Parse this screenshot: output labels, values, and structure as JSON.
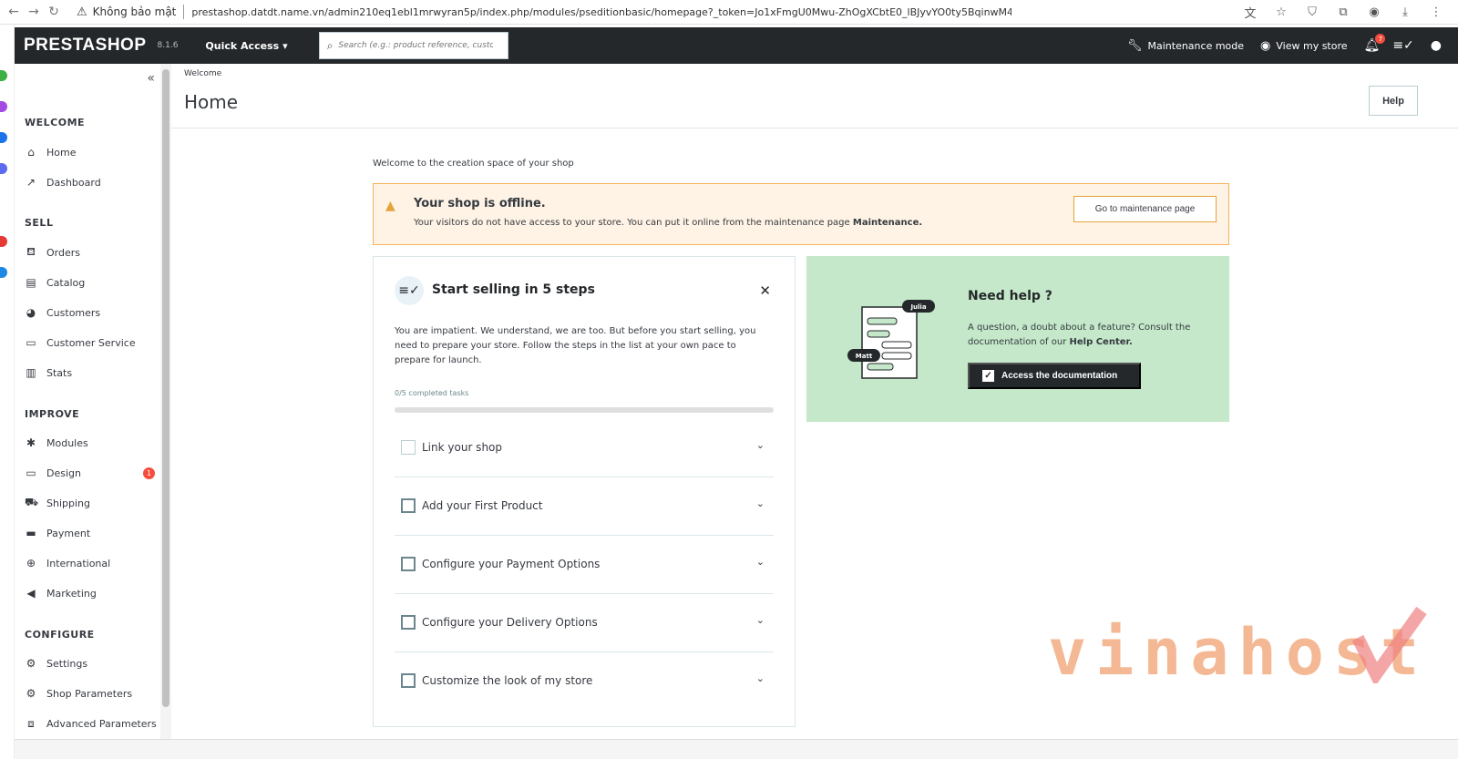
{
  "browser": {
    "security_label": "Không bảo mật",
    "url": "prestashop.datdt.name.vn/admin210eq1ebl1mrwyran5p/index.php/modules/pseditionbasic/homepage?_token=Jo1xFmgU0Mwu-ZhOgXCbtE0_lBJyvYO0ty5BqinwM48"
  },
  "header": {
    "logo": "PRESTASHOP",
    "version": "8.1.6",
    "quick_access": "Quick Access",
    "search_placeholder": "Search (e.g.: product reference, custom",
    "maintenance_mode": "Maintenance mode",
    "view_store": "View my store",
    "notification_count": "7"
  },
  "sidebar": {
    "sections": [
      {
        "title": "WELCOME",
        "items": [
          {
            "label": "Home",
            "icon": "home-icon"
          },
          {
            "label": "Dashboard",
            "icon": "trending-up-icon"
          }
        ]
      },
      {
        "title": "SELL",
        "items": [
          {
            "label": "Orders",
            "icon": "basket-icon"
          },
          {
            "label": "Catalog",
            "icon": "store-icon"
          },
          {
            "label": "Customers",
            "icon": "account-circle-icon"
          },
          {
            "label": "Customer Service",
            "icon": "chat-icon"
          },
          {
            "label": "Stats",
            "icon": "bar-chart-icon"
          }
        ]
      },
      {
        "title": "IMPROVE",
        "items": [
          {
            "label": "Modules",
            "icon": "puzzle-icon"
          },
          {
            "label": "Design",
            "icon": "desktop-icon",
            "badge": "1"
          },
          {
            "label": "Shipping",
            "icon": "truck-icon"
          },
          {
            "label": "Payment",
            "icon": "credit-card-icon"
          },
          {
            "label": "International",
            "icon": "globe-icon"
          },
          {
            "label": "Marketing",
            "icon": "megaphone-icon"
          }
        ]
      },
      {
        "title": "CONFIGURE",
        "items": [
          {
            "label": "Settings",
            "icon": "gear-icon"
          },
          {
            "label": "Shop Parameters",
            "icon": "gear-icon"
          },
          {
            "label": "Advanced Parameters",
            "icon": "advanced-settings-icon"
          }
        ]
      }
    ]
  },
  "page": {
    "breadcrumb": "Welcome",
    "title": "Home",
    "help_button": "Help"
  },
  "main": {
    "welcome_text": "Welcome to the creation space of your shop",
    "alert": {
      "title": "Your shop is offline.",
      "desc_prefix": "Your visitors do not have access to your store. You can put it online from the maintenance page ",
      "desc_bold": "Maintenance.",
      "button": "Go to maintenance page"
    },
    "steps": {
      "title": "Start selling in 5 steps",
      "description": "You are impatient. We understand, we are too. But before you start selling, you need to prepare your store. Follow the steps in the list at your own pace to prepare for launch.",
      "progress_label": "0/5 completed tasks",
      "progress_fraction": 0,
      "tasks": [
        {
          "label": "Link your shop"
        },
        {
          "label": "Add your First Product"
        },
        {
          "label": "Configure your Payment Options"
        },
        {
          "label": "Configure your Delivery Options"
        },
        {
          "label": "Customize the look of my store"
        }
      ]
    },
    "help": {
      "title": "Need help ?",
      "desc_prefix": "A question, a doubt about a feature? Consult the documentation of our ",
      "desc_bold": "Help Center.",
      "button": "Access the documentation",
      "illus_name_1": "Julia",
      "illus_name_2": "Matt"
    }
  },
  "watermark": "vinahost."
}
